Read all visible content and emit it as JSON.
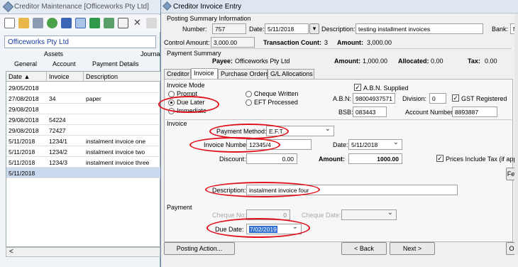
{
  "bg": {
    "title": "Creditor Maintenance  [Officeworks Pty Ltd]",
    "company": "Officeworks Pty Ltd",
    "tabs_row1": [
      "Assets",
      "Journa"
    ],
    "tabs_row2": [
      "General",
      "Account",
      "Payment Details"
    ],
    "columns": [
      "Date",
      "Invoice",
      "Description"
    ],
    "rows": [
      {
        "date": "29/05/2018",
        "invoice": "",
        "desc": ""
      },
      {
        "date": "27/08/2018",
        "invoice": "34",
        "desc": "paper"
      },
      {
        "date": "29/08/2018",
        "invoice": "",
        "desc": ""
      },
      {
        "date": "29/08/2018",
        "invoice": "54224",
        "desc": ""
      },
      {
        "date": "29/08/2018",
        "invoice": "72427",
        "desc": ""
      },
      {
        "date": "5/11/2018",
        "invoice": "1234/1",
        "desc": "instalment invoice one"
      },
      {
        "date": "5/11/2018",
        "invoice": "1234/2",
        "desc": "instalment invoice two"
      },
      {
        "date": "5/11/2018",
        "invoice": "1234/3",
        "desc": "instalment invoice three"
      },
      {
        "date": "5/11/2018",
        "invoice": "",
        "desc": ""
      }
    ],
    "scroll_left": "<"
  },
  "dlg": {
    "title": "Creditor Invoice Entry",
    "summary": {
      "heading": "Posting Summary Information",
      "number_label": "Number:",
      "number": "757",
      "date_label": "Date:",
      "date": "5/11/2018",
      "desc_label": "Description:",
      "desc": "testing installment invoices",
      "bank_label": "Bank:",
      "bank": "M",
      "control_label": "Control Amount:",
      "control": "3,000.00",
      "txcount_label": "Transaction Count:",
      "txcount": "3",
      "amount_label": "Amount:",
      "amount": "3,000.00"
    },
    "payment_summary": {
      "heading": "Payment Summary",
      "payee_label": "Payee:",
      "payee": "Officeworks Pty Ltd",
      "amount_label": "Amount:",
      "amount": "1,000.00",
      "allocated_label": "Allocated:",
      "allocated": "0.00",
      "tax_label": "Tax:",
      "tax": "0.00"
    },
    "tabs": [
      "Creditor",
      "Invoice",
      "Purchase Orders",
      "G/L Allocations"
    ],
    "invoice_mode": {
      "heading": "Invoice Mode",
      "options": [
        "Prompt",
        "Due Later",
        "Immediate"
      ],
      "options2": [
        "Cheque Written",
        "EFT Processed"
      ],
      "selected": "Due Later"
    },
    "abn": {
      "supplied_label": "A.B.N. Supplied",
      "abn_label": "A.B.N:",
      "abn": "98004937571",
      "division_label": "Division:",
      "division": "0",
      "gst_label": "GST Registered",
      "bsb_label": "BSB:",
      "bsb": "083443",
      "acct_label": "Account Number:",
      "acct": "8893887"
    },
    "invoice": {
      "heading": "Invoice",
      "method_label": "Payment Method:",
      "method": "E.F.T.",
      "number_label": "Invoice Number:",
      "number": "12345/4",
      "date_label": "Date:",
      "date": "5/11/2018",
      "discount_label": "Discount:",
      "discount": "0.00",
      "amount_label": "Amount:",
      "amount": "1000.00",
      "prices_tax_label": "Prices Include Tax (if applic",
      "fe_button": "Fe",
      "desc_label": "Description:",
      "desc": "instalment invoice four"
    },
    "payment": {
      "heading": "Payment",
      "cheque_no_label": "Cheque No:",
      "cheque_no": "0",
      "cheque_date_label": "Cheque Date:",
      "due_label": "Due Date:",
      "due": "7/02/2019"
    },
    "buttons": {
      "posting_action": "Posting Action...",
      "back": "< Back",
      "next": "Next >",
      "o": "O"
    }
  }
}
